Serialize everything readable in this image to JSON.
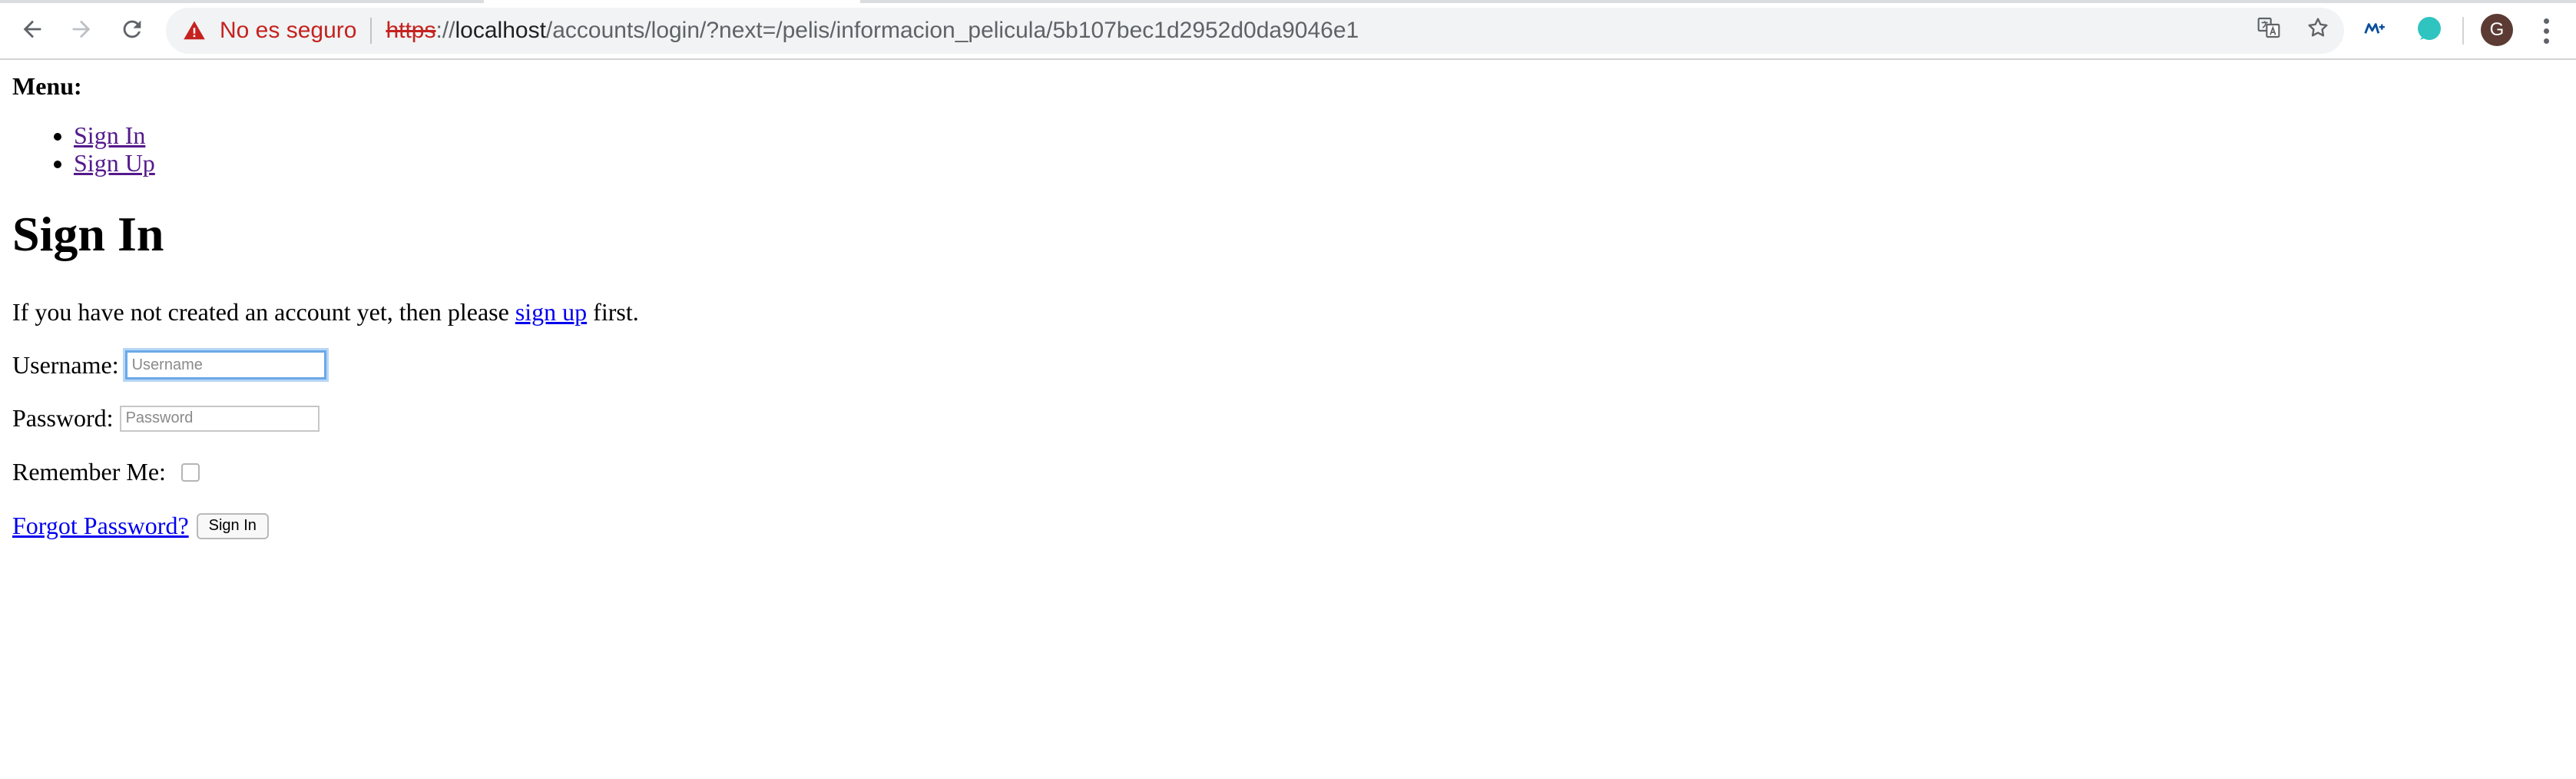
{
  "browser": {
    "security_warning": "No es seguro",
    "url": {
      "scheme": "https",
      "separator": "://",
      "host": "localhost",
      "path": "/accounts/login/?next=/pelis/informacion_pelicula/5b107bec1d2952d0da9046e1"
    },
    "icons": [
      "back-icon",
      "forward-icon",
      "reload-icon",
      "warning-icon",
      "translate-icon",
      "bookmark-star-icon",
      "movistar-extension-icon",
      "circle-extension-icon",
      "more-menu-icon"
    ],
    "profile_initial": "G",
    "colors": {
      "warning": "#c5221f",
      "omnibox_bg": "#f1f3f4",
      "avatar_bg": "#5b3b33",
      "extension_teal": "#2fc4c0"
    }
  },
  "page": {
    "menu_label": "Menu:",
    "menu_items": [
      {
        "label": "Sign In"
      },
      {
        "label": "Sign Up"
      }
    ],
    "heading": "Sign In",
    "intro": {
      "before": "If you have not created an account yet, then please ",
      "link": "sign up",
      "after": " first."
    },
    "form": {
      "username_label": "Username:",
      "username_placeholder": "Username",
      "username_value": "",
      "password_label": "Password:",
      "password_placeholder": "Password",
      "password_value": "",
      "remember_label": "Remember Me:",
      "remember_checked": false,
      "forgot_link": "Forgot Password?",
      "submit_label": "Sign In"
    },
    "colors": {
      "link": "#0000ee",
      "visited_link": "#551a8b"
    }
  }
}
